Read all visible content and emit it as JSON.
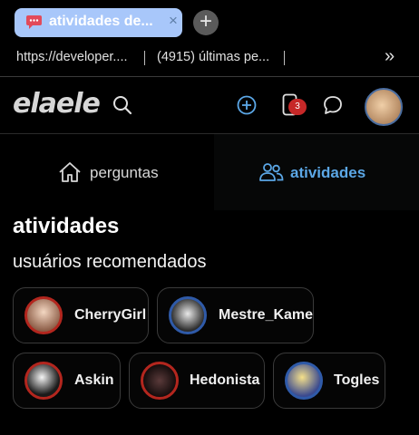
{
  "browser": {
    "tab": {
      "title": "atividades de...",
      "close_glyph": "×",
      "favicon": "chat-bubble-icon"
    },
    "new_tab_glyph": "+",
    "bookmarks": [
      {
        "label": "https://developer...."
      },
      {
        "label": "(4915) últimas pe..."
      }
    ],
    "more_glyph": "»"
  },
  "header": {
    "logo": "elaele",
    "notification_count": "3"
  },
  "nav": {
    "tabs": [
      {
        "label": "perguntas",
        "icon": "home-icon",
        "active": false
      },
      {
        "label": "atividades",
        "icon": "users-icon",
        "active": true
      }
    ]
  },
  "main": {
    "title": "atividades",
    "subtitle": "usuários recomendados",
    "users": [
      {
        "name": "CherryGirl",
        "ring": "red"
      },
      {
        "name": "Mestre_Kame",
        "ring": "blue"
      },
      {
        "name": "Askin",
        "ring": "red"
      },
      {
        "name": "Hedonista",
        "ring": "red"
      },
      {
        "name": "Togles",
        "ring": "blue"
      }
    ]
  },
  "colors": {
    "accent": "#5ba7e6",
    "tab_bg": "#a8c7fa",
    "badge": "#c62828",
    "ring_red": "#b3261e",
    "ring_blue": "#2f5aa8"
  }
}
